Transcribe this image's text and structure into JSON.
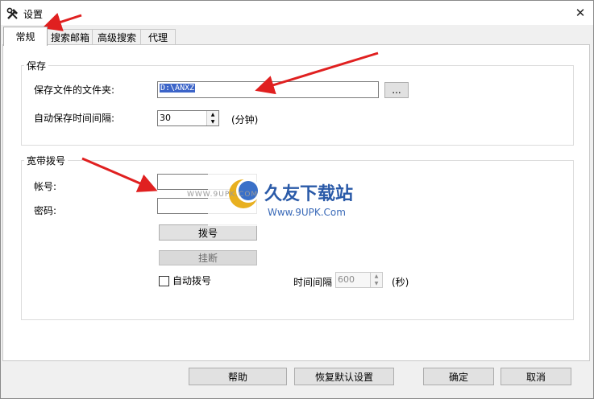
{
  "window": {
    "title": "设置",
    "close_symbol": "✕"
  },
  "tabs": [
    {
      "label": "常规",
      "active": true
    },
    {
      "label": "搜索邮箱",
      "active": false
    },
    {
      "label": "高级搜索",
      "active": false
    },
    {
      "label": "代理",
      "active": false
    }
  ],
  "save_group": {
    "title": "保存",
    "folder_label": "保存文件的文件夹:",
    "folder_value": "D:\\ANXZ",
    "browse_label": "...",
    "autosave_label": "自动保存时间间隔:",
    "autosave_value": "30",
    "autosave_unit": "(分钟)"
  },
  "broadband_group": {
    "title": "宽带拨号",
    "account_label": "帐号:",
    "account_value": "",
    "password_label": "密码:",
    "password_value": "",
    "dial_label": "拨号",
    "hangup_label": "挂断",
    "auto_dial_label": "自动拨号",
    "interval_label": "时间间隔",
    "interval_value": "600",
    "interval_unit": "(秒)"
  },
  "footer": {
    "help_label": "帮助",
    "restore_label": "恢复默认设置",
    "ok_label": "确定",
    "cancel_label": "取消"
  },
  "watermark": {
    "brand": "久友下载站",
    "url": "Www.9UPK.Com",
    "faint_url": "WWW.9UPK.COM"
  },
  "colors": {
    "annotation_arrow": "#e02020",
    "selection": "#3c64c8"
  }
}
